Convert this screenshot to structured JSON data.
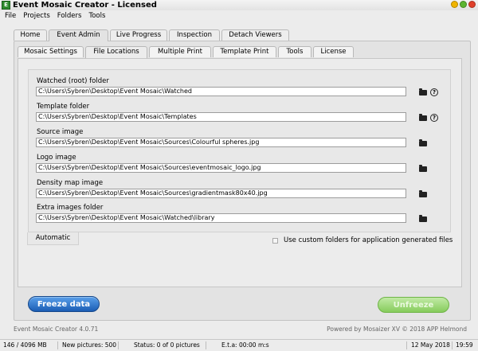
{
  "window": {
    "title": "Event Mosaic Creator - Licensed",
    "icon_letter": "E"
  },
  "menu": [
    "File",
    "Projects",
    "Folders",
    "Tools"
  ],
  "main_tabs": [
    {
      "label": "Home",
      "active": false
    },
    {
      "label": "Event Admin",
      "active": true
    },
    {
      "label": "Live Progress",
      "active": false
    },
    {
      "label": "Inspection",
      "active": false
    },
    {
      "label": "Detach Viewers",
      "active": false
    }
  ],
  "sub_tabs": [
    {
      "label": "Mosaic Settings",
      "active": false
    },
    {
      "label": "File Locations",
      "active": true
    },
    {
      "label": "Multiple Print",
      "active": false
    },
    {
      "label": "Template Print",
      "active": false
    },
    {
      "label": "Tools",
      "active": false
    },
    {
      "label": "License",
      "active": false
    }
  ],
  "fields": [
    {
      "label": "Watched (root) folder",
      "value": "C:\\Users\\Sybren\\Desktop\\Event Mosaic\\Watched",
      "has_help": true
    },
    {
      "label": "Template folder",
      "value": "C:\\Users\\Sybren\\Desktop\\Event Mosaic\\Templates",
      "has_help": true
    },
    {
      "label": "Source image",
      "value": "C:\\Users\\Sybren\\Desktop\\Event Mosaic\\Sources\\Colourful spheres.jpg",
      "has_help": false
    },
    {
      "label": "Logo image",
      "value": "C:\\Users\\Sybren\\Desktop\\Event Mosaic\\Sources\\eventmosaic_logo.jpg",
      "has_help": false
    },
    {
      "label": "Density map image",
      "value": "C:\\Users\\Sybren\\Desktop\\Event Mosaic\\Sources\\gradientmask80x40.jpg",
      "has_help": false
    },
    {
      "label": "Extra images folder",
      "value": "C:\\Users\\Sybren\\Desktop\\Event Mosaic\\Watched\\library",
      "has_help": false
    }
  ],
  "automatic_tab": "Automatic",
  "custom_folders_checkbox": {
    "label": "Use custom folders for application generated files",
    "checked": false
  },
  "buttons": {
    "freeze": "Freeze data",
    "unfreeze": "Unfreeze"
  },
  "footer": {
    "version": "Event Mosaic Creator 4.0.71",
    "powered": "Powered by Mosaizer XV © 2018  APP Helmond"
  },
  "status": {
    "memory": "146 / 4096 MB",
    "new_pictures": "New pictures: 500",
    "status_text": "Status: 0 of 0 pictures",
    "eta": "E.t.a: 00:00 m:s",
    "date": "12 May 2018",
    "time": "19:59"
  },
  "colors": {
    "freeze_button": "#2f74c9",
    "unfreeze_button": "#9fd97a",
    "minimize": "#f0b400",
    "maximize": "#5cb531",
    "close": "#e0402b"
  }
}
